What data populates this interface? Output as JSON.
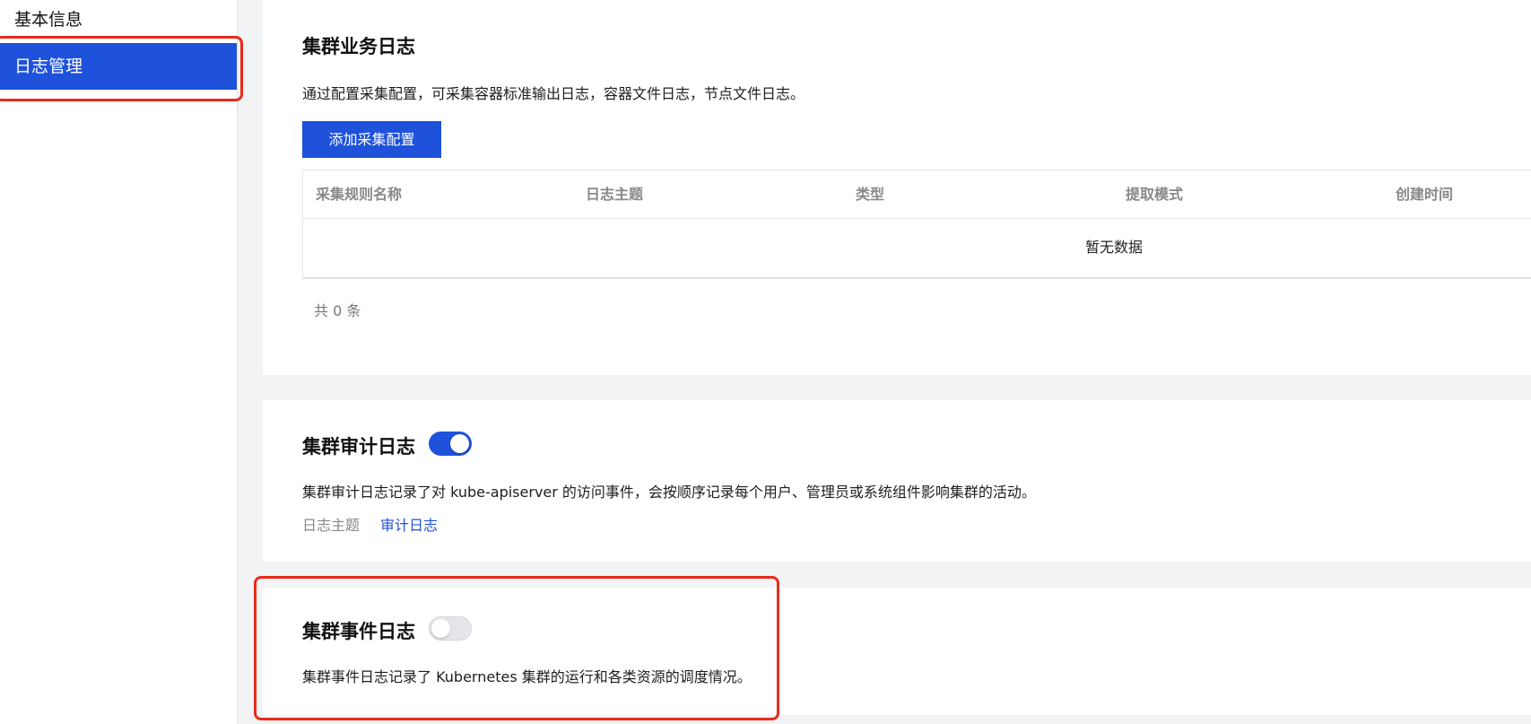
{
  "sidebar": {
    "items": [
      {
        "label": "基本信息"
      },
      {
        "label": "日志管理"
      }
    ]
  },
  "business_log": {
    "title": "集群业务日志",
    "description": "通过配置采集配置，可采集容器标准输出日志，容器文件日志，节点文件日志。",
    "add_button": "添加采集配置",
    "table": {
      "columns": [
        "采集规则名称",
        "日志主题",
        "类型",
        "提取模式",
        "创建时间"
      ],
      "empty_text": "暂无数据"
    },
    "total": "共 0 条"
  },
  "audit_log": {
    "title": "集群审计日志",
    "enabled": true,
    "description": "集群审计日志记录了对 kube-apiserver 的访问事件，会按顺序记录每个用户、管理员或系统组件影响集群的活动。",
    "topic_label": "日志主题",
    "topic_link": "审计日志"
  },
  "event_log": {
    "title": "集群事件日志",
    "enabled": false,
    "description": "集群事件日志记录了 Kubernetes 集群的运行和各类资源的调度情况。"
  },
  "colors": {
    "accent": "#1e52db",
    "annotation": "#ea2b1a",
    "background": "#f2f3f5"
  }
}
